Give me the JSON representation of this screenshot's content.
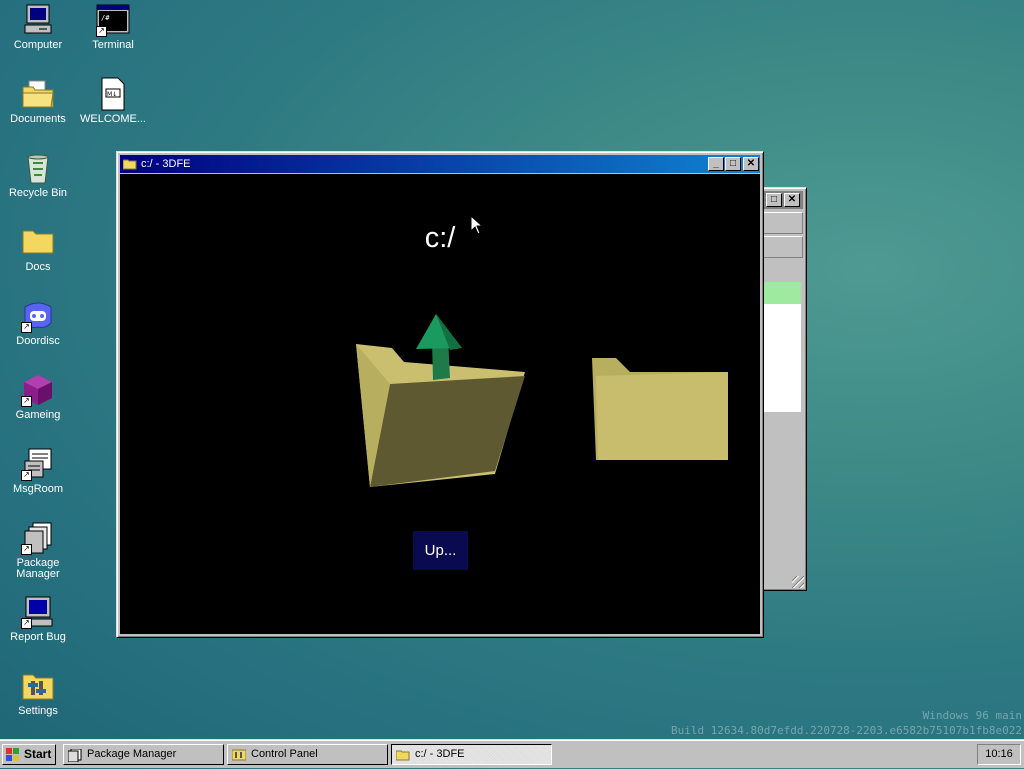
{
  "desktop": {
    "icons": [
      {
        "label": "Computer",
        "icon": "computer-icon"
      },
      {
        "label": "Terminal",
        "icon": "terminal-icon"
      },
      {
        "label": "Documents",
        "icon": "documents-folder-icon"
      },
      {
        "label": "WELCOME...",
        "icon": "markdown-file-icon"
      },
      {
        "label": "Recycle Bin",
        "icon": "recycle-bin-icon"
      },
      {
        "label": "Docs",
        "icon": "folder-icon"
      },
      {
        "label": "Doordisc",
        "icon": "discord-icon"
      },
      {
        "label": "Gameing",
        "icon": "cube-icon"
      },
      {
        "label": "MsgRoom",
        "icon": "msgroom-icon"
      },
      {
        "label": "Package Manager",
        "icon": "package-manager-icon"
      },
      {
        "label": "Report Bug",
        "icon": "report-bug-icon"
      },
      {
        "label": "Settings",
        "icon": "settings-icon"
      }
    ]
  },
  "main_window": {
    "title": "c:/ - 3DFE",
    "path_heading": "c:/",
    "up_button": "Up...",
    "minimize": "_",
    "maximize": "□",
    "close": "✕"
  },
  "back_window": {
    "maximize": "□",
    "close": "✕"
  },
  "watermark": {
    "line1": "Windows 96 main",
    "line2": "Build 12634.80d7efdd.220728-2203.e6582b75107b1fb8e022"
  },
  "taskbar": {
    "start_label": "Start",
    "tasks": [
      {
        "label": "Package Manager",
        "active": false
      },
      {
        "label": "Control Panel",
        "active": false
      },
      {
        "label": "c:/ - 3DFE",
        "active": true
      }
    ],
    "clock": "10:16"
  },
  "colors": {
    "titlebar_start": "#000080",
    "titlebar_end": "#1084d0",
    "folder": "#c9bf6e",
    "arrow": "#1a8a5a"
  }
}
